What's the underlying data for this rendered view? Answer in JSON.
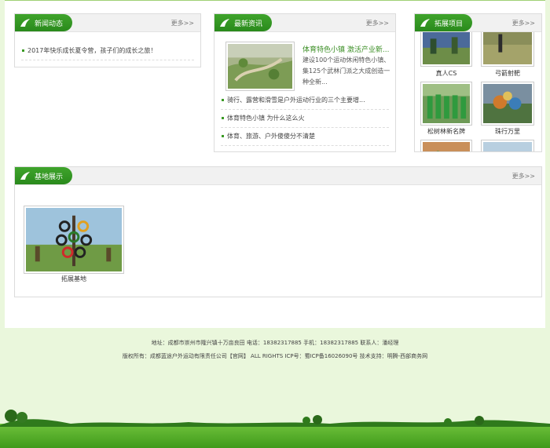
{
  "news": {
    "title": "新闻动态",
    "more": "更多>>",
    "items": [
      "2017年快乐成长夏令营，孩子们的成长之旅！"
    ]
  },
  "latest": {
    "title": "最新资讯",
    "more": "更多>>",
    "featured": {
      "headline": "体育特色小镇 激活产业新...",
      "summary_lines": [
        "建设100个运动休闲特色小镇、",
        "集125个武林门派之大成创造一",
        "种全新..."
      ]
    },
    "items": [
      "骑行、露营和滑雪是户外运动行业的三个主要增...",
      "体育特色小镇 为什么这么火",
      "体育、旅游、户外傻傻分不清楚"
    ]
  },
  "expand": {
    "title": "拓展项目",
    "more": "更多>>",
    "items": [
      "真人CS",
      "弓箭射靶",
      "松树林新名牌",
      "珠行万里"
    ]
  },
  "base": {
    "title": "基地展示",
    "more": "更多>>",
    "items": [
      "拓展基地"
    ]
  },
  "footer": {
    "line1": "地址：成都市崇州市隆兴镇十万亩良田    电话：18382317885    手机：18382317885    联系人：潘经理",
    "line2": "版权所有：成都蓝途户外运动有限责任公司【官网】    ALL RIGHTS    ICP号：蜀ICP备16026090号    技术支持：明腾-西部商务网"
  },
  "colors": {
    "accent": "#2f961f",
    "background": "#eaf7dc",
    "headline": "#3c8f26"
  }
}
